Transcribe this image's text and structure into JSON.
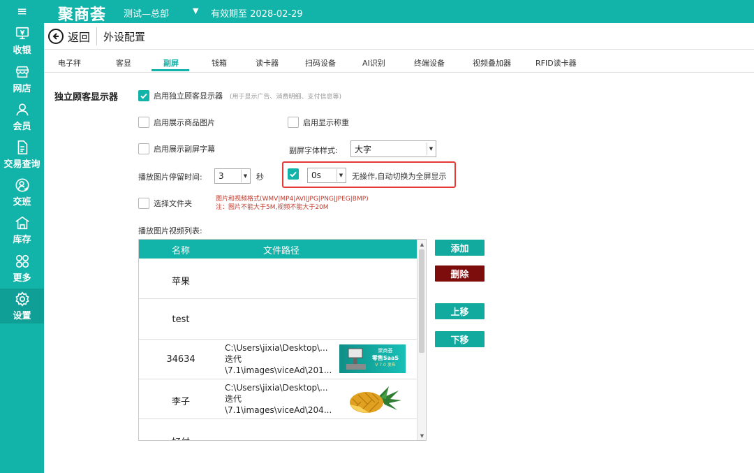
{
  "topbar": {
    "logo": "聚商荟",
    "store": "测试—总部",
    "expiry": "有效期至 2028-02-29"
  },
  "sidebar": {
    "items": [
      {
        "label": "收银",
        "icon": "cashier-icon"
      },
      {
        "label": "网店",
        "icon": "store-icon"
      },
      {
        "label": "会员",
        "icon": "member-icon"
      },
      {
        "label": "交易查询",
        "icon": "document-icon"
      },
      {
        "label": "交班",
        "icon": "shift-icon"
      },
      {
        "label": "库存",
        "icon": "warehouse-icon"
      },
      {
        "label": "更多",
        "icon": "more-icon"
      },
      {
        "label": "设置",
        "icon": "settings-icon",
        "active": true
      }
    ]
  },
  "header": {
    "back_label": "返回",
    "title": "外设配置"
  },
  "tabs": [
    "电子秤",
    "客显",
    "副屏",
    "钱箱",
    "读卡器",
    "扫码设备",
    "AI识别",
    "终端设备",
    "视频叠加器",
    "RFID读卡器"
  ],
  "active_tab": "副屏",
  "section_title": "独立顾客显示器",
  "options": {
    "enable_display": {
      "label": "启用独立顾客显示器",
      "hint": "(用于显示广告、消费明细、支付信息等)",
      "checked": true
    },
    "show_product_image": {
      "label": "启用展示商品图片",
      "checked": false
    },
    "show_weight": {
      "label": "启用显示称重",
      "checked": false
    },
    "show_subtitle": {
      "label": "启用展示副屏字幕",
      "checked": false
    },
    "font_style_label": "副屏字体样式:",
    "font_style_value": "大字",
    "image_duration_label": "播放图片停留时间:",
    "image_duration_value": "3",
    "image_duration_unit": "秒",
    "idle_fullscreen": {
      "checked": true,
      "value": "0s",
      "label": "无操作,自动切换为全屏显示"
    },
    "select_folder": {
      "label": "选择文件夹",
      "checked": false
    },
    "format_note": "图片和视频格式(WMV|MP4|AVI|JPG|PNG|JPEG|BMP)",
    "size_note": "注：图片不能大于5M,视频不能大于20M"
  },
  "playlist": {
    "label": "播放图片视频列表:",
    "columns": [
      "名称",
      "文件路径"
    ],
    "rows": [
      {
        "name": "苹果",
        "path": []
      },
      {
        "name": "test",
        "path": []
      },
      {
        "name": "34634",
        "path": [
          "C:\\Users\\jixia\\Desktop\\...",
          "迭代",
          "\\7.1\\images\\viceAd\\201..."
        ],
        "thumb": "saas"
      },
      {
        "name": "李子",
        "path": [
          "C:\\Users\\jixia\\Desktop\\...",
          "迭代",
          "\\7.1\\images\\viceAd\\204..."
        ],
        "thumb": "pineapple"
      },
      {
        "name": "好付",
        "path": []
      }
    ],
    "thumb_text": {
      "line1": "聚商荟",
      "line2": "零售SaaS",
      "line3": "V 7.0 发布"
    }
  },
  "buttons": {
    "add": "添加",
    "delete": "删除",
    "move_up": "上移",
    "move_down": "下移"
  }
}
